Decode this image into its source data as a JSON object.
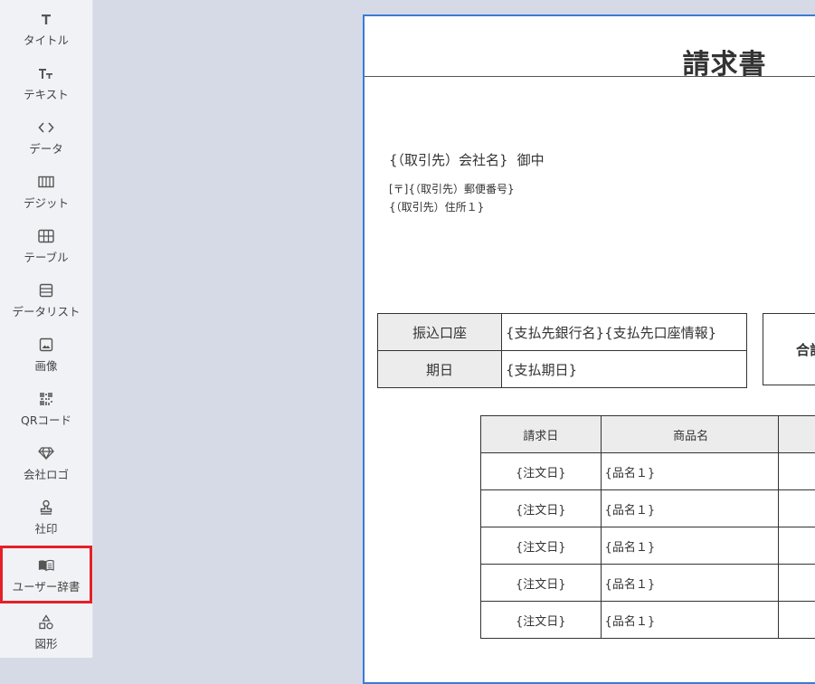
{
  "sidebar": {
    "items": [
      {
        "label": "タイトル",
        "icon": "title-icon"
      },
      {
        "label": "テキスト",
        "icon": "text-icon"
      },
      {
        "label": "データ",
        "icon": "code-icon"
      },
      {
        "label": "デジット",
        "icon": "digit-icon"
      },
      {
        "label": "テーブル",
        "icon": "table-icon"
      },
      {
        "label": "データリスト",
        "icon": "datalist-icon"
      },
      {
        "label": "画像",
        "icon": "image-icon"
      },
      {
        "label": "QRコード",
        "icon": "qrcode-icon"
      },
      {
        "label": "会社ロゴ",
        "icon": "diamond-icon"
      },
      {
        "label": "社印",
        "icon": "stamp-icon"
      },
      {
        "label": "ユーザー辞書",
        "icon": "book-icon"
      },
      {
        "label": "図形",
        "icon": "shapes-icon"
      }
    ],
    "highlight_color": "#e5202a"
  },
  "document": {
    "title": "請求書",
    "recipient_company": "{（取引先）会社名}",
    "recipient_honorific": "御中",
    "postal_line": "[〒]{（取引先）郵便番号}",
    "address_line": "{（取引先）住所１}",
    "payment_rows": [
      {
        "header": "振込口座",
        "value": "{支払先銀行名}{支払先口座情報}"
      },
      {
        "header": "期日",
        "value": "{支払期日}"
      }
    ],
    "total_label": "合計",
    "items_headers": [
      "請求日",
      "商品名"
    ],
    "items_rows": [
      {
        "date": "{注文日}",
        "name": "{品名１}"
      },
      {
        "date": "{注文日}",
        "name": "{品名１}"
      },
      {
        "date": "{注文日}",
        "name": "{品名１}"
      },
      {
        "date": "{注文日}",
        "name": "{品名１}"
      },
      {
        "date": "{注文日}",
        "name": "{品名１}"
      }
    ]
  },
  "colors": {
    "canvas_bg": "#d5dae6",
    "selection_border": "#3a7bd5",
    "table_header_bg": "#ececec"
  }
}
